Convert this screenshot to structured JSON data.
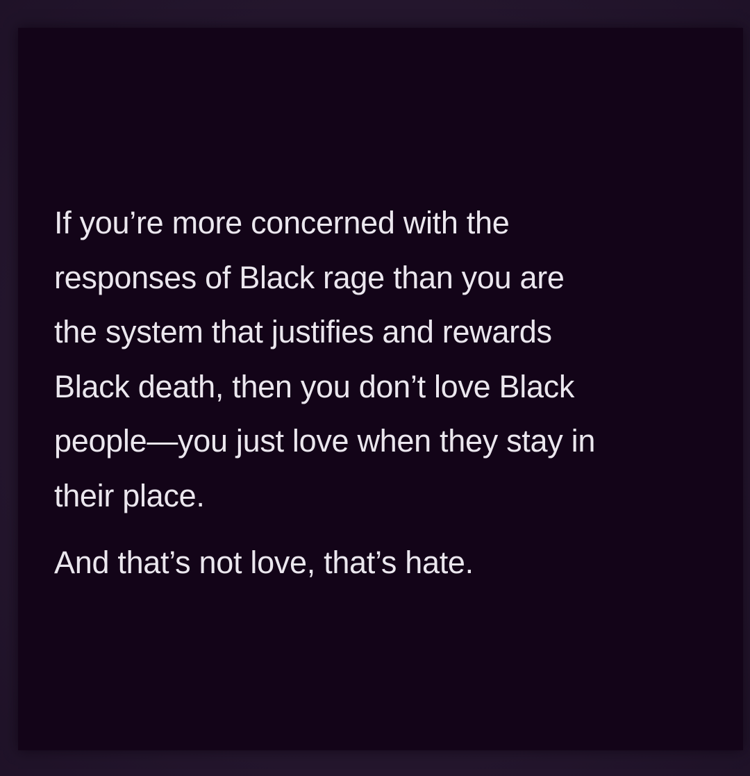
{
  "quote": {
    "lines": [
      "If you’re more concerned with the",
      "responses of Black rage than you are",
      "the system that justifies and rewards",
      "Black death, then you don’t love Black",
      "people—you just love when they stay in",
      "their place."
    ],
    "closing": "And that’s not love, that’s hate."
  },
  "colors": {
    "frame": "#2a1a35",
    "panel": "#130418",
    "text": "#ebe7ee"
  }
}
